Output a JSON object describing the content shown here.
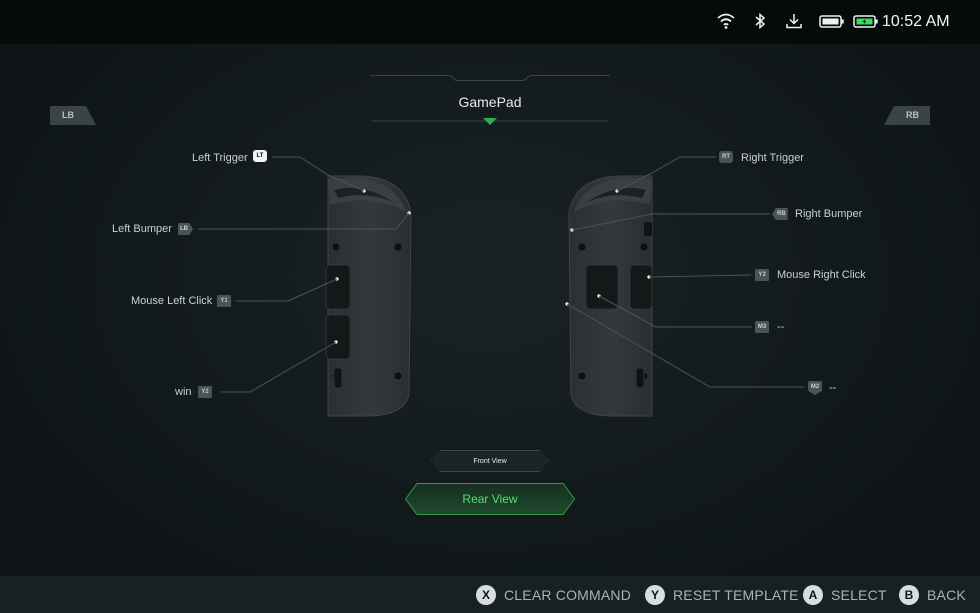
{
  "status_bar": {
    "clock": "10:52 AM",
    "icons": [
      "wifi-icon",
      "bluetooth-icon",
      "download-icon",
      "battery-device-icon",
      "battery-charging-icon"
    ],
    "battery_accent": "#3ddc5a"
  },
  "header": {
    "title": "GamePad",
    "left_bumper_tab": "LB",
    "right_bumper_tab": "RB"
  },
  "mappings": {
    "left_trigger": {
      "label": "Left Trigger",
      "badge": "LT"
    },
    "left_bumper": {
      "label": "Left Bumper",
      "badge": "LB"
    },
    "mouse_left_click": {
      "label": "Mouse Left Click",
      "badge": "Y1"
    },
    "win": {
      "label": "win",
      "badge": "Y2"
    },
    "right_trigger": {
      "label": "Right Trigger",
      "badge": "RT"
    },
    "right_bumper": {
      "label": "Right Bumper",
      "badge": "RB"
    },
    "mouse_right_click": {
      "label": "Mouse Right Click",
      "badge": "Y3"
    },
    "m3": {
      "label": "--",
      "badge": "M3"
    },
    "m2": {
      "label": "--",
      "badge": "M2"
    }
  },
  "views": {
    "front_label": "Front View",
    "rear_label": "Rear View",
    "active_color": "#52e07a"
  },
  "footer": {
    "hints": [
      {
        "key": "X",
        "label": "CLEAR COMMAND"
      },
      {
        "key": "Y",
        "label": "RESET TEMPLATE"
      },
      {
        "key": "A",
        "label": "SELECT"
      },
      {
        "key": "B",
        "label": "BACK"
      }
    ]
  }
}
